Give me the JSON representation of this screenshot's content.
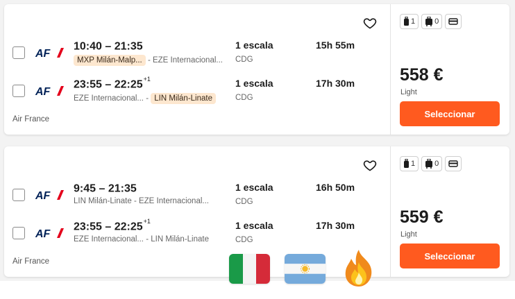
{
  "colors": {
    "accent": "#ff5a1f",
    "highlight_bg": "#fde7cf",
    "airfrance_navy": "#002157",
    "airfrance_red": "#e4001b"
  },
  "icons": [
    "heart-icon",
    "checkbox-icon",
    "airfrance-logo",
    "personal-item-icon",
    "carry-on-bag-icon",
    "checked-baggage-icon",
    "italy-flag-icon",
    "argentina-flag-icon",
    "fire-emoji-icon"
  ],
  "results": [
    {
      "legs": [
        {
          "logo": "AF/",
          "times": "10:40 – 21:35",
          "plus_day": "",
          "origin": "MXP Milán-Malp...",
          "separator": "-",
          "destination": "EZE Internacional...",
          "origin_highlight": true,
          "dest_highlight": false,
          "stops": "1 escala",
          "via": "CDG",
          "duration": "15h 55m"
        },
        {
          "logo": "AF/",
          "times": "23:55 – 22:25",
          "plus_day": "+1",
          "origin": "EZE Internacional...",
          "separator": "-",
          "destination": "LIN Milán-Linate",
          "origin_highlight": false,
          "dest_highlight": true,
          "stops": "1 escala",
          "via": "CDG",
          "duration": "17h 30m"
        }
      ],
      "airline": "Air France",
      "bags": {
        "personal": "1",
        "carry_on": "0"
      },
      "price": "558 €",
      "fare": "Light",
      "button": "Seleccionar"
    },
    {
      "legs": [
        {
          "logo": "AF/",
          "times": "9:45 – 21:35",
          "plus_day": "",
          "origin": "LIN Milán-Linate",
          "separator": "-",
          "destination": "EZE Internacional...",
          "origin_highlight": false,
          "dest_highlight": false,
          "stops": "1 escala",
          "via": "CDG",
          "duration": "16h 50m"
        },
        {
          "logo": "AF/",
          "times": "23:55 – 22:25",
          "plus_day": "+1",
          "origin": "EZE Internacional...",
          "separator": "-",
          "destination": "LIN Milán-Linate",
          "origin_highlight": false,
          "dest_highlight": false,
          "stops": "1 escala",
          "via": "CDG",
          "duration": "17h 30m"
        }
      ],
      "airline": "Air France",
      "bags": {
        "personal": "1",
        "carry_on": "0"
      },
      "price": "559 €",
      "fare": "Light",
      "button": "Seleccionar"
    }
  ]
}
